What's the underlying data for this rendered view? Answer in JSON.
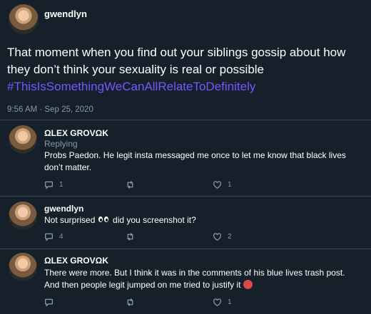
{
  "main_tweet": {
    "author": "gwendlyn",
    "text": "That moment when you find out your siblings gossip about how they don’t think your sexuality is real or possible",
    "hashtag": "#ThisIsSomethingWeCanAllRelateToDefinitely",
    "timestamp": "9:56 AM · Sep 25, 2020"
  },
  "replies": [
    {
      "author": "ΩLEX GROVΩK",
      "sub": "Replying",
      "text": "Probs Paedon. He legit insta messaged me once to let me know that black lives don’t matter.",
      "reply_count": "1",
      "retweet_count": "",
      "like_count": "1"
    },
    {
      "author": "gwendlyn",
      "text_before_emoji": "Not surprised ",
      "emoji": "eyes-emoji",
      "text_after_emoji": " did you screenshot it?",
      "reply_count": "4",
      "retweet_count": "",
      "like_count": "2"
    },
    {
      "author": "ΩLEX GROVΩK",
      "text": "There were more. But I think it was in the comments of his blue lives trash post. And then people legit jumped on me tried to justify it",
      "emoji": "angry-face-emoji",
      "reply_count": "",
      "retweet_count": "",
      "like_count": "1"
    }
  ],
  "colors": {
    "background": "#15202b",
    "hashtag": "#7856ff",
    "muted": "#8899a6",
    "divider": "#38444d"
  }
}
